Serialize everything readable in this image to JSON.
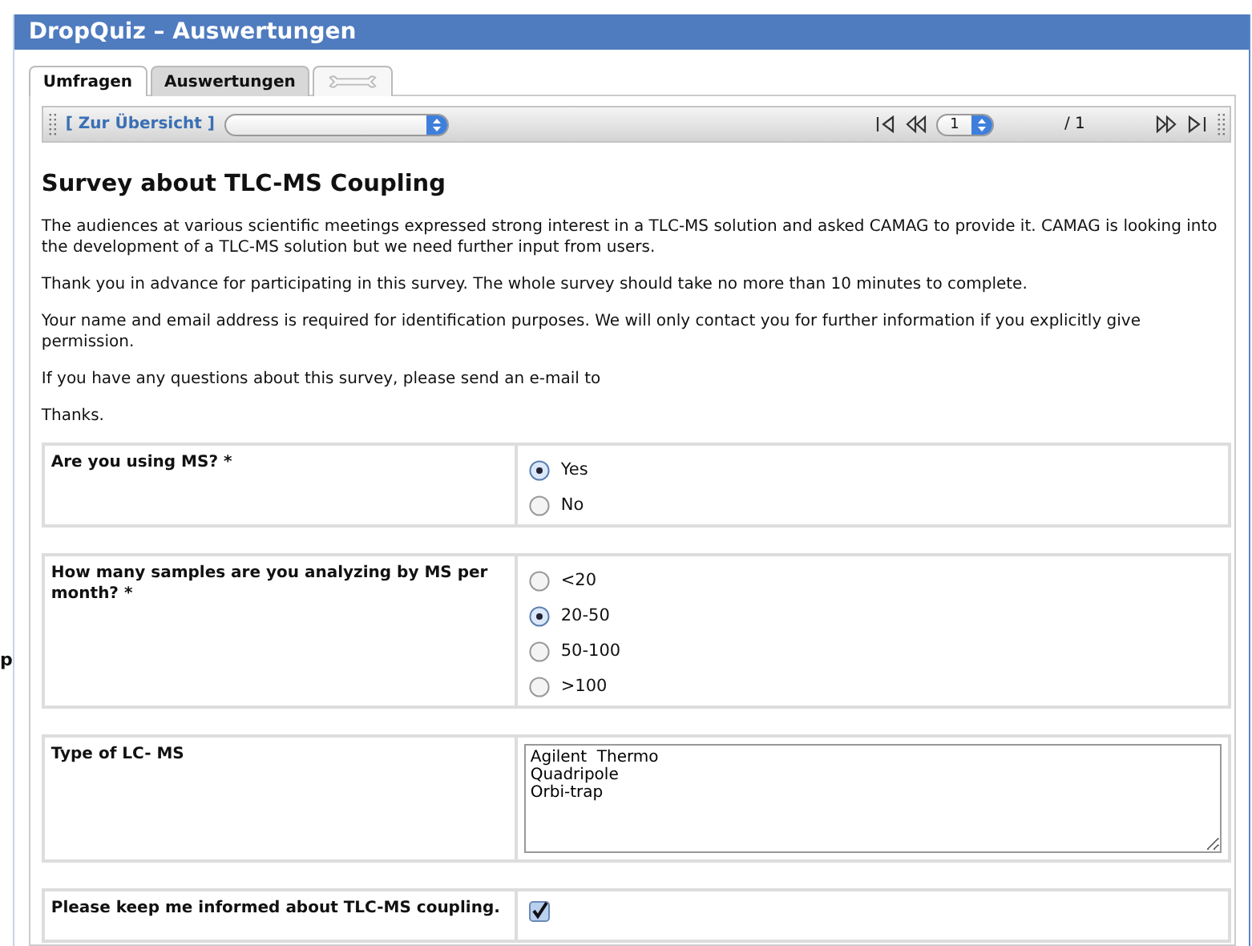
{
  "edge_fragment": "p",
  "window": {
    "title": "DropQuiz – Auswertungen"
  },
  "tabs": [
    {
      "kind": "text",
      "label": "Umfragen",
      "selected": true
    },
    {
      "kind": "text",
      "label": "Auswertungen",
      "selected": false
    },
    {
      "kind": "icon",
      "selected": false
    }
  ],
  "toolbar": {
    "link": "[ Zur Übersicht ]",
    "page": "1",
    "page_total": "/ 1"
  },
  "survey": {
    "title": "Survey about TLC-MS Coupling",
    "paragraphs": [
      "The audiences at various scientific meetings expressed strong interest in a TLC-MS solution and asked CAMAG to provide it. CAMAG is looking into the development of a TLC-MS solution but we need further input from users.",
      "Thank you in advance for participating in this survey. The whole survey should take no more than 10 minutes to complete.",
      "Your name and email address is required for identification purposes. We will only contact you for further information if you explicitly give permission.",
      "If you have any questions about this survey, please send an e-mail to",
      "Thanks."
    ],
    "questions": [
      {
        "kind": "radio",
        "label": "Are you using MS? *",
        "options": [
          {
            "label": "Yes",
            "selected": true
          },
          {
            "label": "No",
            "selected": false
          }
        ]
      },
      {
        "kind": "radio",
        "label": "How many samples are you analyzing by MS per month? *",
        "options": [
          {
            "label": "<20",
            "selected": false
          },
          {
            "label": "20-50",
            "selected": true
          },
          {
            "label": "50-100",
            "selected": false
          },
          {
            "label": ">100",
            "selected": false
          }
        ]
      },
      {
        "kind": "textarea",
        "label": "Type of LC- MS",
        "value": "Agilent  Thermo\nQuadripole\nOrbi-trap"
      },
      {
        "kind": "checkbox",
        "label": "Please keep me informed about TLC-MS coupling.",
        "checked": true
      }
    ]
  }
}
